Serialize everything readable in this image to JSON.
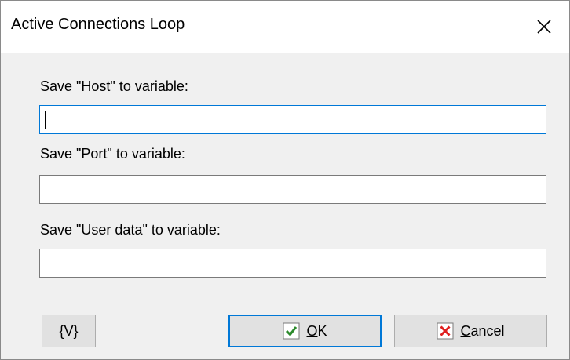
{
  "dialog": {
    "title": "Active Connections Loop",
    "close_icon": "close-icon"
  },
  "fields": [
    {
      "label": "Save \"Host\" to variable:",
      "value": "",
      "placeholder": ""
    },
    {
      "label": "Save \"Port\" to variable:",
      "value": "",
      "placeholder": ""
    },
    {
      "label": "Save \"User data\" to variable:",
      "value": "",
      "placeholder": ""
    }
  ],
  "buttons": {
    "variables": {
      "label": "{V}"
    },
    "ok": {
      "access_key": "O",
      "rest": "K",
      "icon": "checkmark-icon",
      "icon_color": "#2b8a2b"
    },
    "cancel": {
      "access_key": "C",
      "rest": "ancel",
      "icon": "red-x-icon",
      "icon_color": "#e02020"
    }
  },
  "colors": {
    "focus_accent": "#0078d7",
    "button_face": "#e1e1e1",
    "window_bg": "#f0f0f0"
  }
}
